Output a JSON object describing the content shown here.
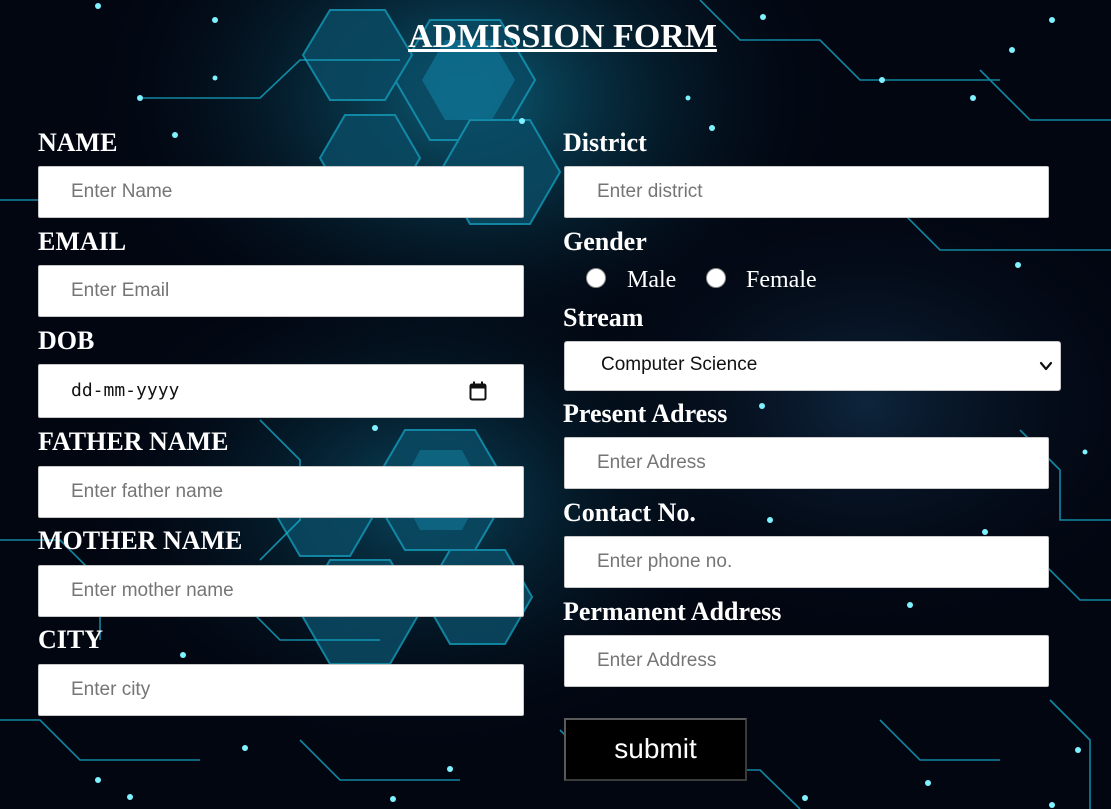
{
  "form": {
    "title": "ADMISSION FORM",
    "left": [
      {
        "label": "NAME",
        "placeholder": "Enter Name"
      },
      {
        "label": "EMAIL",
        "placeholder": "Enter Email"
      },
      {
        "label": "DOB",
        "value": "dd-mm-yyyy"
      },
      {
        "label": "FATHER NAME",
        "placeholder": "Enter father name"
      },
      {
        "label": "MOTHER NAME",
        "placeholder": "Enter mother name"
      },
      {
        "label": "CITY",
        "placeholder": "Enter city"
      }
    ],
    "district": {
      "label": "District",
      "placeholder": "Enter district"
    },
    "gender": {
      "label": "Gender",
      "options": [
        "Male",
        "Female"
      ]
    },
    "stream": {
      "label": "Stream",
      "selected": "Computer Science"
    },
    "present_address": {
      "label": "Present Adress",
      "placeholder": "Enter Adress"
    },
    "contact": {
      "label": "Contact No.",
      "placeholder": "Enter phone no."
    },
    "permanent_address": {
      "label": "Permanent Address",
      "placeholder": "Enter Address"
    },
    "submit_label": "submit"
  },
  "icons": {
    "date_picker": "calendar-icon",
    "select_arrow": "chevron-down-icon"
  },
  "colors": {
    "background": "#020611",
    "accent_cyan": "#19c8e6",
    "text": "#ffffff",
    "button": "#000000"
  }
}
